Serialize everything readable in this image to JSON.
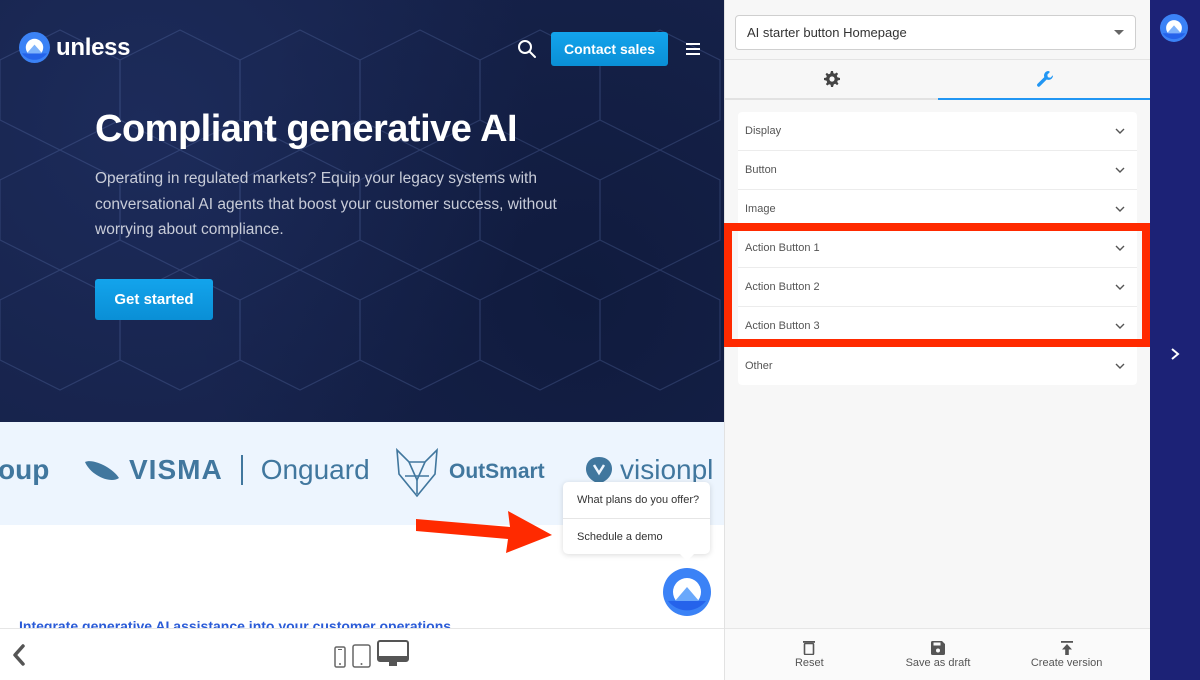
{
  "preview": {
    "brand_name": "unless",
    "nav": {
      "contact_label": "Contact sales"
    },
    "hero": {
      "title": "Compliant generative AI",
      "subtitle": "Operating in regulated markets? Equip your legacy systems with conversational AI agents that boost your customer success, without worrying about compliance.",
      "cta_label": "Get started"
    },
    "logos": {
      "group_partial": "oup",
      "visma": "VISMA",
      "onguard": "Onguard",
      "outsmart": "OutSmart",
      "visionplanner_partial": "visionpl"
    },
    "integrate_link": "Integrate generative AI assistance into your customer operations",
    "popup": {
      "items": [
        "What plans do you offer?",
        "Schedule a demo"
      ]
    }
  },
  "bottom_bar": {
    "devices": [
      "mobile",
      "tablet",
      "desktop"
    ],
    "active_device": "desktop"
  },
  "editor": {
    "variant_select": {
      "value": "AI starter button Homepage"
    },
    "tabs": [
      {
        "icon": "gear-icon",
        "active": false
      },
      {
        "icon": "wrench-icon",
        "active": true
      }
    ],
    "sections": [
      "Display",
      "Button",
      "Image",
      "Action Button 1",
      "Action Button 2",
      "Action Button 3",
      "Other"
    ],
    "highlighted_sections": [
      "Action Button 1",
      "Action Button 2",
      "Action Button 3"
    ],
    "footer": {
      "reset_label": "Reset",
      "save_label": "Save as draft",
      "create_label": "Create version"
    }
  },
  "colors": {
    "accent": "#2196f3",
    "cta": "#0a8fd6",
    "highlight": "#ff2a00",
    "strip": "#1c2276",
    "hero_bg": "#16224a"
  }
}
